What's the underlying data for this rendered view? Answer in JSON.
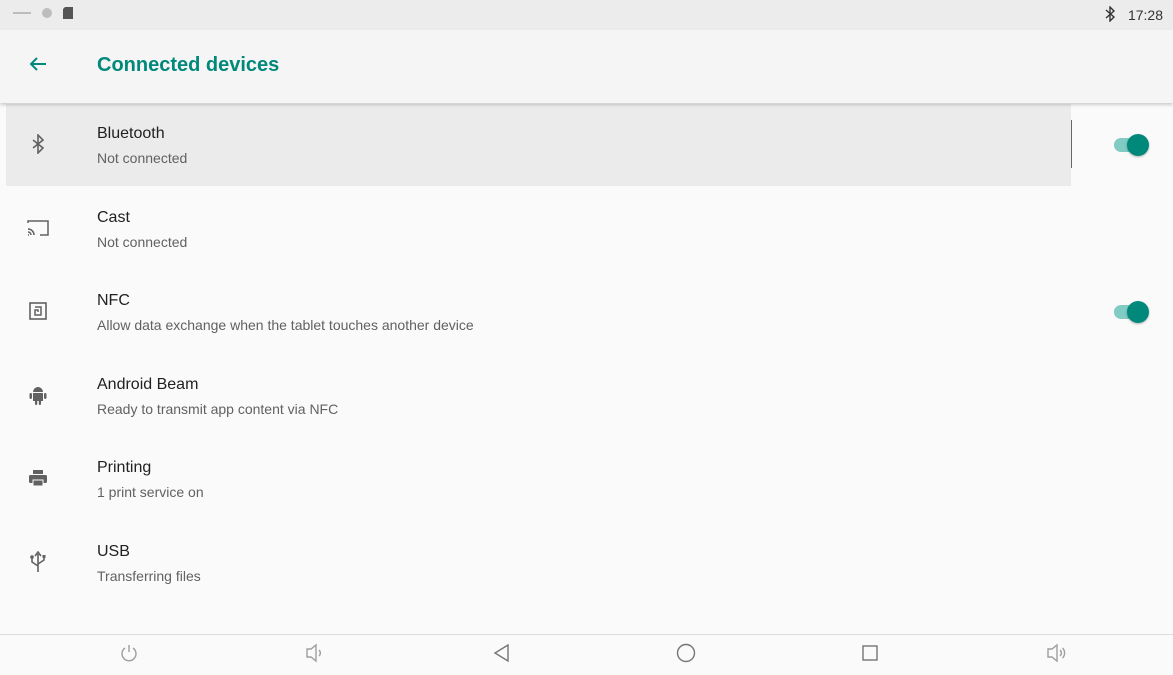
{
  "status_bar": {
    "time": "17:28",
    "icons": [
      "minus-icon",
      "circle-icon",
      "sd-card-icon",
      "bluetooth-icon"
    ]
  },
  "app_bar": {
    "title": "Connected devices",
    "back_icon": "arrow-left-icon"
  },
  "accent_color": "#00897b",
  "items": [
    {
      "icon": "bluetooth-icon",
      "title": "Bluetooth",
      "summary": "Not connected",
      "toggle": true,
      "toggle_on": true
    },
    {
      "icon": "cast-icon",
      "title": "Cast",
      "summary": "Not connected",
      "toggle": false
    },
    {
      "icon": "nfc-icon",
      "title": "NFC",
      "summary": "Allow data exchange when the tablet touches another device",
      "toggle": true,
      "toggle_on": true
    },
    {
      "icon": "android-icon",
      "title": "Android Beam",
      "summary": "Ready to transmit app content via NFC",
      "toggle": false
    },
    {
      "icon": "printer-icon",
      "title": "Printing",
      "summary": "1 print service on",
      "toggle": false
    },
    {
      "icon": "usb-icon",
      "title": "USB",
      "summary": "Transferring files",
      "toggle": false
    }
  ],
  "nav_bar": {
    "buttons": [
      "power-icon",
      "volume-down-icon",
      "back-triangle-icon",
      "home-circle-icon",
      "recents-square-icon",
      "volume-up-icon"
    ]
  }
}
